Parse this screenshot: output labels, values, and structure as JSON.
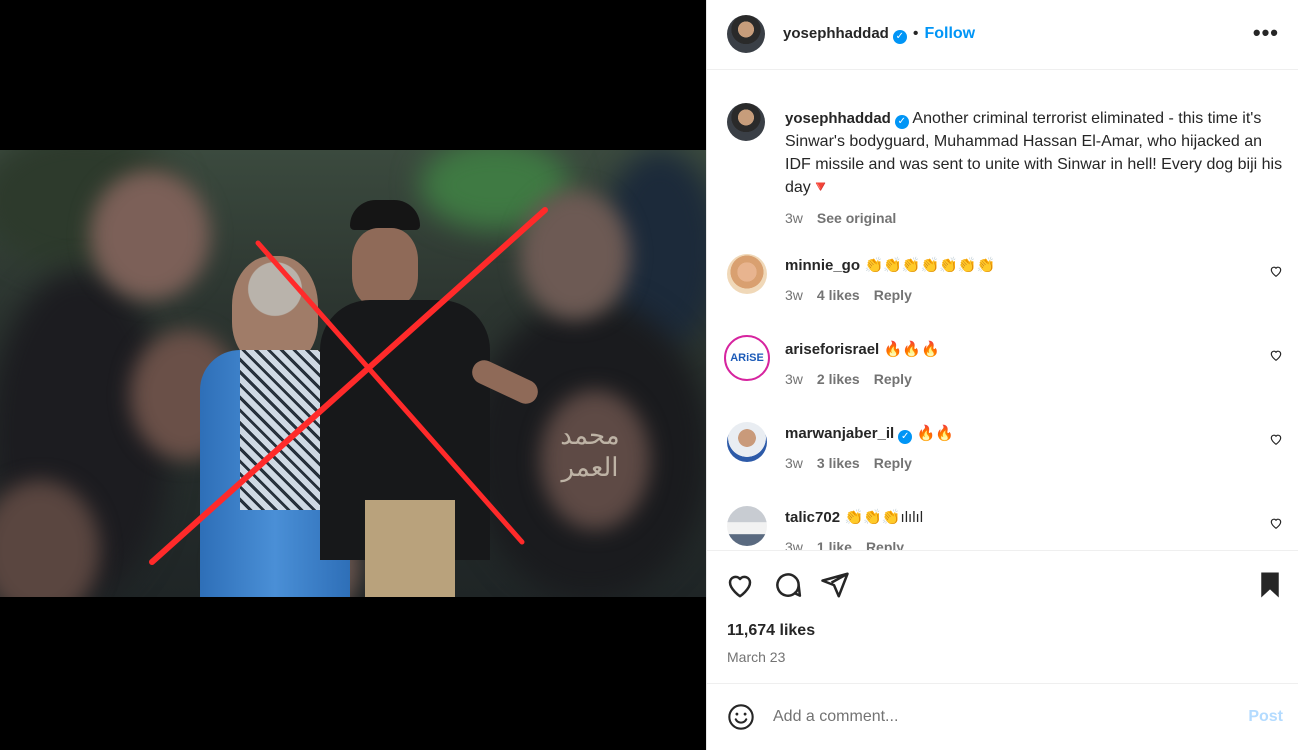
{
  "post_header": {
    "username": "yosephhaddad",
    "separator": "•",
    "follow_label": "Follow",
    "more_label": "•••"
  },
  "caption": {
    "username": "yosephhaddad",
    "text": "Another criminal terrorist eliminated - this time it's Sinwar's bodyguard, Muhammad Hassan El-Amar, who hijacked an IDF missile and was sent to unite with Sinwar in hell! Every dog biji his day🔻",
    "time": "3w",
    "see_original": "See original"
  },
  "comments": [
    {
      "username": "minnie_go",
      "text": "👏👏👏👏👏👏👏",
      "time": "3w",
      "likes": "4 likes",
      "reply": "Reply",
      "verified": false
    },
    {
      "username": "ariseforisrael",
      "text": "🔥🔥🔥",
      "time": "3w",
      "likes": "2 likes",
      "reply": "Reply",
      "verified": false,
      "avatar_text": "ARiSE"
    },
    {
      "username": "marwanjaber_il",
      "text": "🔥🔥",
      "time": "3w",
      "likes": "3 likes",
      "reply": "Reply",
      "verified": true
    },
    {
      "username": "talic702",
      "text": "👏👏👏ılılıl",
      "time": "3w",
      "likes": "1 like",
      "reply": "Reply",
      "verified": false
    }
  ],
  "engagement": {
    "likes": "11,674 likes",
    "date": "March 23"
  },
  "add_comment": {
    "placeholder": "Add a comment...",
    "post_label": "Post"
  },
  "media": {
    "watermark": "محمد العمر"
  },
  "colors": {
    "accent_blue": "#0095f6",
    "post_disabled": "#b3dbff",
    "red_x": "#ff2a2a"
  }
}
